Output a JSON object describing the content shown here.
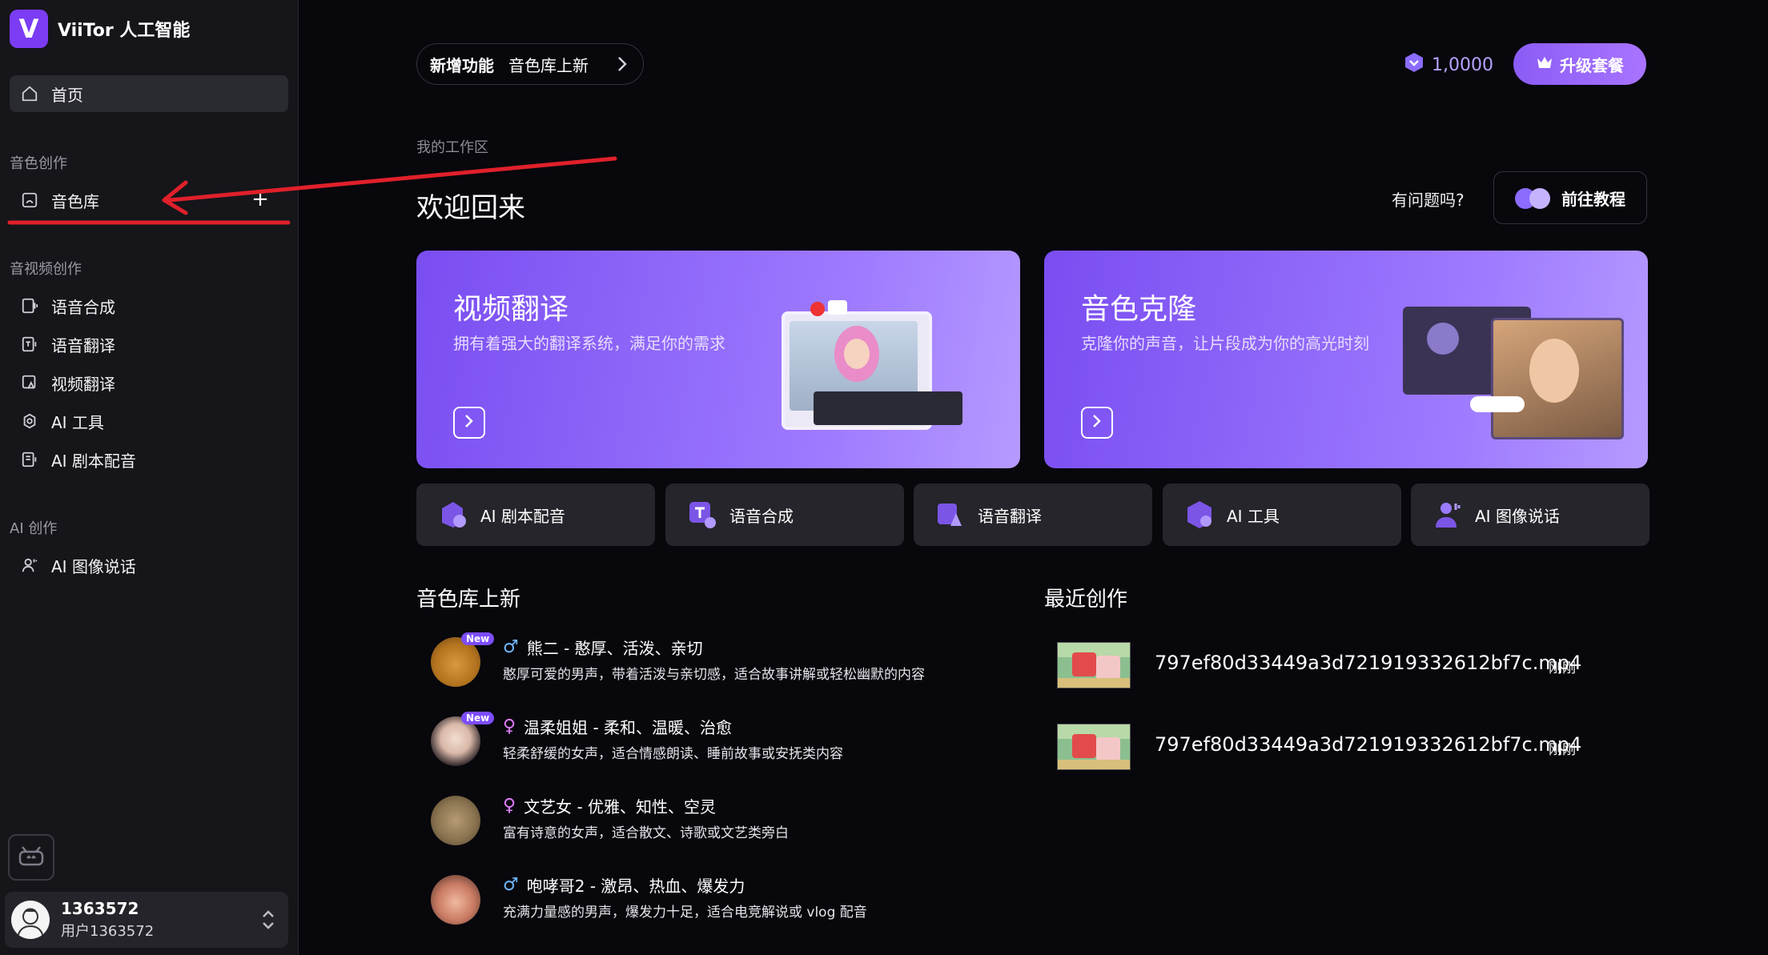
{
  "brand": {
    "logo_letter": "V",
    "name": "ViiTor 人工智能"
  },
  "sidebar": {
    "home": "首页",
    "sections": [
      {
        "title": "音色创作",
        "items": [
          "音色库"
        ]
      },
      {
        "title": "音视频创作",
        "items": [
          "语音合成",
          "语音翻译",
          "视频翻译",
          "AI 工具",
          "AI 剧本配音"
        ]
      },
      {
        "title": "AI 创作",
        "items": [
          "AI 图像说话"
        ]
      }
    ],
    "add_symbol": "+"
  },
  "user": {
    "id": "1363572",
    "name": "用户1363572"
  },
  "header": {
    "new_tag": "新增功能",
    "new_text": "音色库上新",
    "credits": "1,0000",
    "upgrade": "升级套餐"
  },
  "workspace": {
    "label": "我的工作区",
    "welcome": "欢迎回来",
    "help_question": "有问题吗?",
    "tutorial": "前往教程"
  },
  "features": [
    {
      "title": "视频翻译",
      "desc": "拥有着强大的翻译系统，满足你的需求"
    },
    {
      "title": "音色克隆",
      "desc": "克隆你的声音，让片段成为你的高光时刻"
    }
  ],
  "shortcuts": [
    "AI 剧本配音",
    "语音合成",
    "语音翻译",
    "AI 工具",
    "AI 图像说话"
  ],
  "voice_library": {
    "title": "音色库上新",
    "new_badge": "New",
    "male_symbol": "♂",
    "female_symbol": "♀",
    "items": [
      {
        "name": "熊二 - 憨厚、活泼、亲切",
        "desc": "憨厚可爱的男声，带着活泼与亲切感，适合故事讲解或轻松幽默的内容"
      },
      {
        "name": "温柔姐姐 - 柔和、温暖、治愈",
        "desc": "轻柔舒缓的女声，适合情感朗读、睡前故事或安抚类内容"
      },
      {
        "name": "文艺女 - 优雅、知性、空灵",
        "desc": "富有诗意的女声，适合散文、诗歌或文艺类旁白"
      },
      {
        "name": "咆哮哥2 - 激昂、热血、爆发力",
        "desc": "充满力量感的男声，爆发力十足，适合电竞解说或 vlog 配音"
      }
    ]
  },
  "recent": {
    "title": "最近创作",
    "items": [
      {
        "name": "797ef80d33449a3d721919332612bf7c.mp4",
        "time": "刚刚"
      },
      {
        "name": "797ef80d33449a3d721919332612bf7c.mp4",
        "time": "刚刚"
      }
    ]
  },
  "colors": {
    "accent": "#8b5cf6",
    "annotation": "#e0202a"
  }
}
